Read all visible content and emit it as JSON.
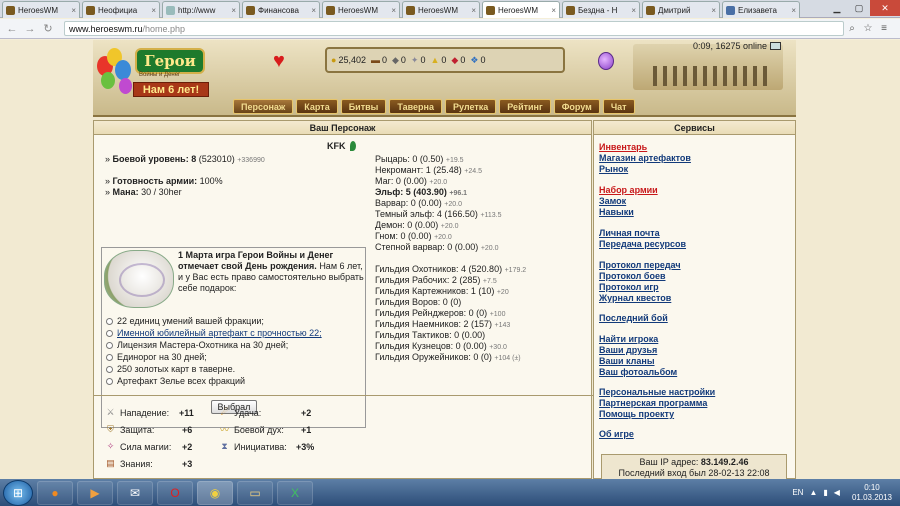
{
  "browser": {
    "tabs": [
      {
        "label": "HeroesWM",
        "icon": "heroes-icon",
        "active": false
      },
      {
        "label": "Неофициа",
        "icon": "heroes-icon",
        "active": false
      },
      {
        "label": "http://www",
        "icon": "page-icon",
        "active": false
      },
      {
        "label": "Финансова",
        "icon": "heroes-icon",
        "active": false
      },
      {
        "label": "HeroesWM",
        "icon": "heroes-icon",
        "active": false
      },
      {
        "label": "HeroesWM",
        "icon": "heroes-icon",
        "active": false
      },
      {
        "label": "HeroesWM",
        "icon": "heroes-icon",
        "active": true
      },
      {
        "label": "Бездна - H",
        "icon": "heroes-icon",
        "active": false
      },
      {
        "label": "Дмитрий",
        "icon": "heroes-icon",
        "active": false
      },
      {
        "label": "Елизавета",
        "icon": "vk-icon",
        "active": false
      }
    ],
    "url_host": "www.heroeswm.ru",
    "url_path": "/home.php"
  },
  "header": {
    "logo_title": "Герои",
    "logo_sub": "Войны и Денег",
    "logo_years": "Нам 6 лет!",
    "resources": [
      {
        "icon": "gold-icon",
        "value": "25,402"
      },
      {
        "icon": "wood-icon",
        "value": "0"
      },
      {
        "icon": "ore-icon",
        "value": "0"
      },
      {
        "icon": "mercury-icon",
        "value": "0"
      },
      {
        "icon": "sulfur-icon",
        "value": "0"
      },
      {
        "icon": "crystal-icon",
        "value": "0"
      },
      {
        "icon": "gems-icon",
        "value": "0"
      }
    ],
    "online": "0:09, 16275 online",
    "menu": [
      "Персонаж",
      "Карта",
      "Битвы",
      "Таверна",
      "Рулетка",
      "Рейтинг",
      "Форум",
      "Чат"
    ]
  },
  "character": {
    "panel_title": "Ваш Персонаж",
    "name": "KFK",
    "combat_level_label": "Боевой уровень:",
    "combat_level": "8",
    "combat_exp": "(523010)",
    "combat_exp_delta": "+336990",
    "army_ready_label": "Готовность армии:",
    "army_ready": "100%",
    "mana_label": "Мана:",
    "mana": "30 / 30her",
    "guilds": [
      {
        "text": "Рыцарь: 0 (0.50)",
        "delta": "+19.5"
      },
      {
        "text": "Некромант: 1 (25.48)",
        "delta": "+24.5"
      },
      {
        "text": "Маг: 0 (0.00)",
        "delta": "+20.0"
      },
      {
        "text": "Эльф: 5 (403.90)",
        "delta": "+96.1",
        "bold": true
      },
      {
        "text": "Варвар: 0 (0.00)",
        "delta": "+20.0"
      },
      {
        "text": "Темный эльф: 4 (166.50)",
        "delta": "+113.5"
      },
      {
        "text": "Демон: 0 (0.00)",
        "delta": "+20.0"
      },
      {
        "text": "Гном: 0 (0.00)",
        "delta": "+20.0"
      },
      {
        "text": "Степной варвар: 0 (0.00)",
        "delta": "+20.0"
      }
    ],
    "guild_stats": [
      {
        "text": "Гильдия Охотников: 4 (520.80)",
        "delta": "+179.2"
      },
      {
        "text": "Гильдия Рабочих: 2 (285)",
        "delta": "+7.5"
      },
      {
        "text": "Гильдия Картежников: 1 (10)",
        "delta": "+20"
      },
      {
        "text": "Гильдия Воров: 0 (0)",
        "delta": ""
      },
      {
        "text": "Гильдия Рейнджеров: 0 (0)",
        "delta": "+100"
      },
      {
        "text": "Гильдия Наемников: 2 (157)",
        "delta": "+143"
      },
      {
        "text": "Гильдия Тактиков: 0 (0.00)",
        "delta": ""
      },
      {
        "text": "Гильдия Кузнецов: 0 (0.00)",
        "delta": "+30.0"
      },
      {
        "text": "Гильдия Оружейников: 0 (0)",
        "delta": "+104 (±)"
      }
    ],
    "birthday": {
      "title": "1 Марта игра Герои Войны и Денег отмечает свой День рождения.",
      "body": "Нам 6 лет, и у Вас есть право самостоятельно выбрать себе подарок:",
      "options": [
        "22 единиц умений вашей фракции;",
        "Именной юбилейный артефакт с прочностью 22;",
        "Лицензия Мастера-Охотника на 30 дней;",
        "Единорог на 30 дней;",
        "250 золотых карт в таверне.",
        "Артефакт Зелье всех фракций"
      ],
      "button": "Выбрал"
    },
    "attributes": [
      {
        "icon": "attack-icon",
        "label": "Нападение:",
        "value": "+11"
      },
      {
        "icon": "defense-icon",
        "label": "Защита:",
        "value": "+6"
      },
      {
        "icon": "magic-icon",
        "label": "Сила магии:",
        "value": "+2"
      },
      {
        "icon": "knowledge-icon",
        "label": "Знания:",
        "value": "+3"
      },
      {
        "icon": "luck-icon",
        "label": "Удача:",
        "value": "+2"
      },
      {
        "icon": "morale-icon",
        "label": "Боевой дух:",
        "value": "+1"
      },
      {
        "icon": "initiative-icon",
        "label": "Инициатива:",
        "value": "+3%"
      }
    ]
  },
  "services": {
    "panel_title": "Сервисы",
    "links": [
      {
        "label": "Инвентарь",
        "red": true
      },
      {
        "label": "Магазин артефактов"
      },
      {
        "label": "Рынок"
      },
      {
        "label": "Набор армии",
        "red": true
      },
      {
        "label": "Замок"
      },
      {
        "label": "Навыки"
      },
      {
        "label": "Личная почта"
      },
      {
        "label": "Передача ресурсов"
      },
      {
        "label": "Протокол передач"
      },
      {
        "label": "Протокол боев"
      },
      {
        "label": "Протокол игр"
      },
      {
        "label": "Журнал квестов"
      },
      {
        "label": "Последний бой"
      },
      {
        "label": "Найти игрока"
      },
      {
        "label": "Ваши друзья"
      },
      {
        "label": "Ваши кланы"
      },
      {
        "label": "Ваш фотоальбом"
      },
      {
        "label": "Персональные настройки"
      },
      {
        "label": "Партнерская программа"
      },
      {
        "label": "Помощь проекту"
      },
      {
        "label": "Об игре"
      }
    ],
    "ip_label": "Ваш IP адрес:",
    "ip": "83.149.2.46",
    "last_login": "Последний вход был 28-02-13 22:08"
  },
  "taskbar": {
    "lang": "EN",
    "time": "0:10",
    "date": "01.03.2013"
  }
}
